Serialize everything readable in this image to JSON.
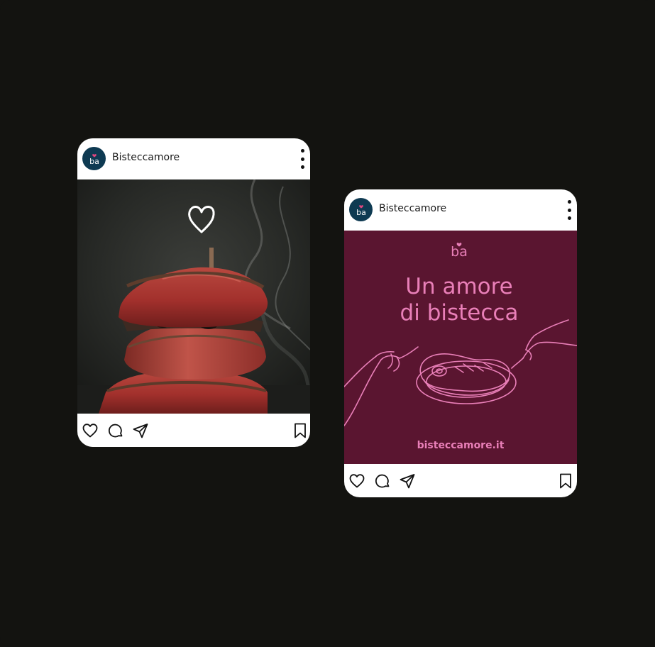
{
  "posts": [
    {
      "username": "Bisteccamore",
      "avatar_text": "ba",
      "media": "steak-photo"
    },
    {
      "username": "Bisteccamore",
      "avatar_text": "ba",
      "media": "brand-graphic",
      "graphic": {
        "logo_text": "ba",
        "headline_line1": "Un amore",
        "headline_line2": "di bistecca",
        "website": "bisteccamore.it"
      }
    }
  ],
  "icons": [
    "heart-icon",
    "comment-icon",
    "share-icon",
    "bookmark-icon",
    "more-options-icon"
  ],
  "colors": {
    "background": "#131310",
    "brand_burgundy": "#5a1530",
    "brand_pink": "#e97fb8",
    "avatar_teal": "#0e3a52",
    "avatar_heart": "#e0467f"
  }
}
